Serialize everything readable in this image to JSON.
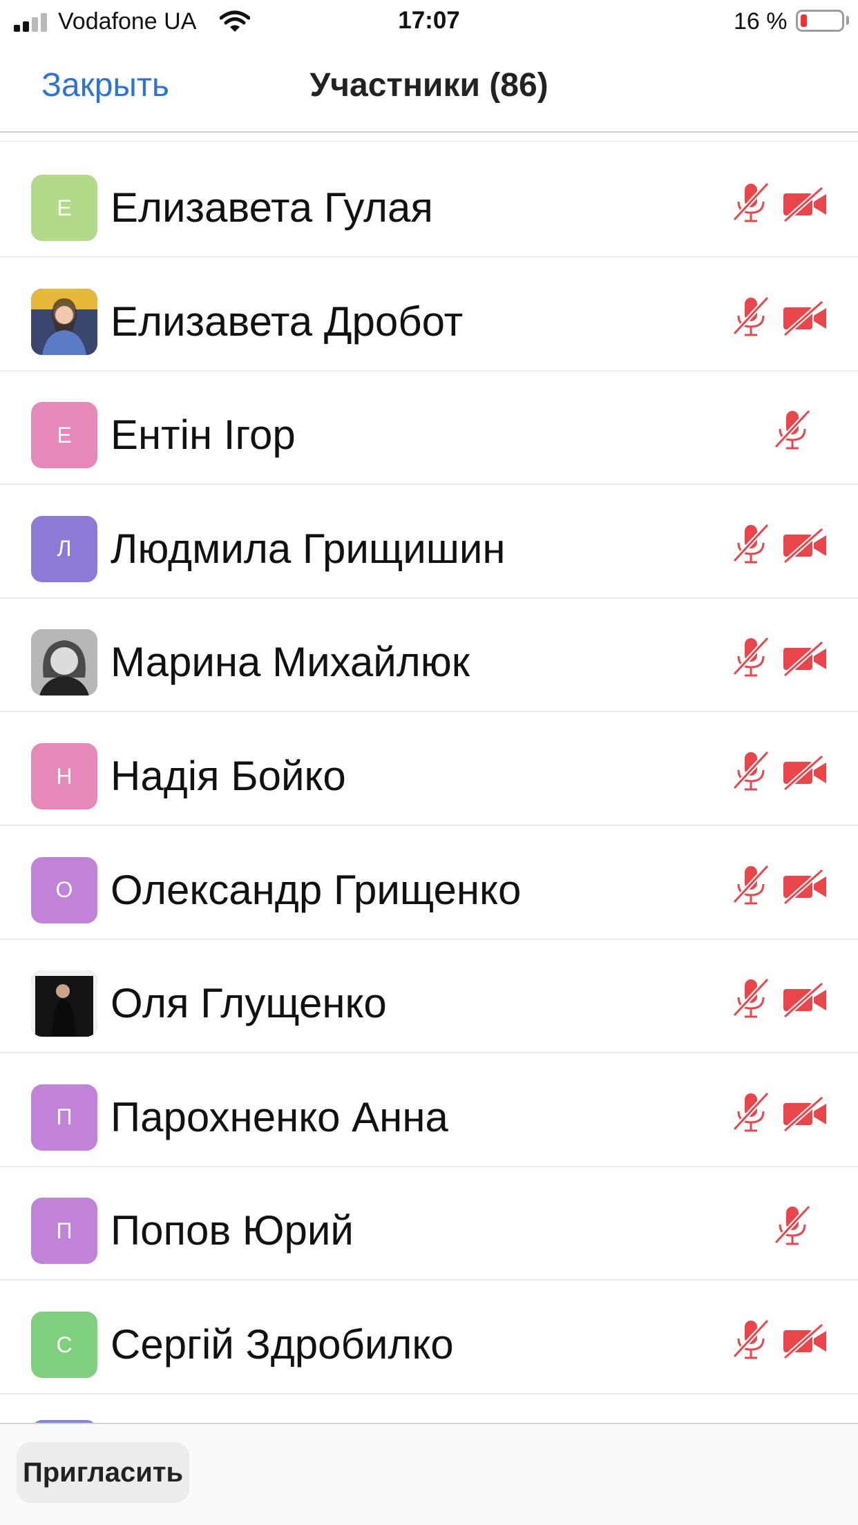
{
  "status_bar": {
    "carrier": "Vodafone UA",
    "time": "17:07",
    "battery_percent": "16 %"
  },
  "nav": {
    "close_label": "Закрыть",
    "title": "Участники (86)"
  },
  "participants": [
    {
      "name": "Елизавета Гулая",
      "initial": "Е",
      "avatar_color": "#b3d98a",
      "photo": false,
      "mic_muted": true,
      "video_off": true
    },
    {
      "name": "Елизавета Дробот",
      "initial": "",
      "avatar_color": "#39466e",
      "photo": true,
      "mic_muted": true,
      "video_off": true
    },
    {
      "name": "Ентін Ігор",
      "initial": "Е",
      "avatar_color": "#e58ab8",
      "photo": false,
      "mic_muted": true,
      "video_off": false
    },
    {
      "name": "Людмила Грищишин",
      "initial": "Л",
      "avatar_color": "#8f79d6",
      "photo": false,
      "mic_muted": true,
      "video_off": true
    },
    {
      "name": "Марина Михайлюк",
      "initial": "",
      "avatar_color": "#8a8a8a",
      "photo": true,
      "mic_muted": true,
      "video_off": true
    },
    {
      "name": "Надія Бойко",
      "initial": "Н",
      "avatar_color": "#e58ab8",
      "photo": false,
      "mic_muted": true,
      "video_off": true
    },
    {
      "name": "Олександр Грищенко",
      "initial": "О",
      "avatar_color": "#c183d8",
      "photo": false,
      "mic_muted": true,
      "video_off": true
    },
    {
      "name": "Оля Глущенко",
      "initial": "",
      "avatar_color": "#1d1d1d",
      "photo": true,
      "mic_muted": true,
      "video_off": true
    },
    {
      "name": "Парохненко Анна",
      "initial": "П",
      "avatar_color": "#c183d8",
      "photo": false,
      "mic_muted": true,
      "video_off": true
    },
    {
      "name": "Попов Юрий",
      "initial": "П",
      "avatar_color": "#c183d8",
      "photo": false,
      "mic_muted": true,
      "video_off": false
    },
    {
      "name": "Сергій Здробилко",
      "initial": "С",
      "avatar_color": "#7fcf7f",
      "photo": false,
      "mic_muted": true,
      "video_off": true
    }
  ],
  "bottom": {
    "invite_label": "Пригласить"
  },
  "colors": {
    "accent": "#2d72d9",
    "muted_red": "#e8464a",
    "separator": "#ededed"
  }
}
